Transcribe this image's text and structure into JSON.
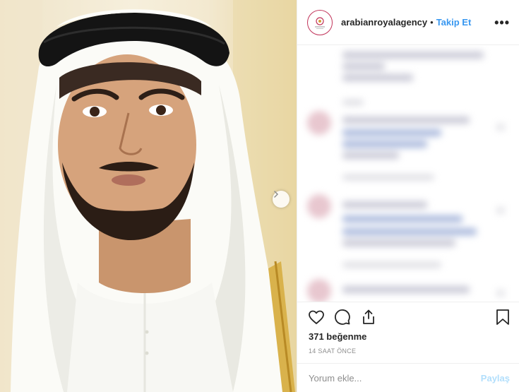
{
  "post": {
    "image_alt": "Portrait photo"
  },
  "header": {
    "username": "arabianroyalagency",
    "separator": "•",
    "follow_label": "Takip Et",
    "more_label": "•••"
  },
  "actions": {
    "icons": [
      "heart-icon",
      "comment-icon",
      "share-icon",
      "bookmark-icon"
    ]
  },
  "stats": {
    "likes": "371 beğenme",
    "timestamp": "14 SAAT ÖNCE"
  },
  "comment": {
    "placeholder": "Yorum ekle...",
    "post_label": "Paylaş"
  },
  "colors": {
    "accent": "#3897f0",
    "post_disabled": "#b2dffc",
    "avatar_ring": "#c1345a"
  }
}
